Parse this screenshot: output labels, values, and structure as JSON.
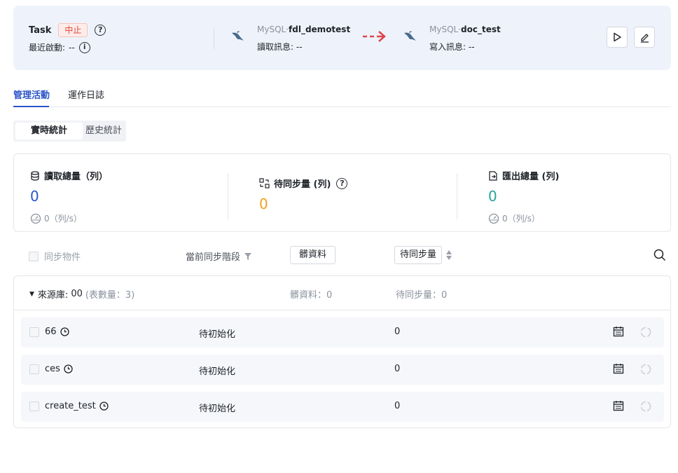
{
  "header": {
    "task_label": "Task",
    "status": "中止",
    "help_icon": "question-circle-icon",
    "recent_label": "最近啟動:",
    "recent_value": "--",
    "source": {
      "prefix": "MySQL·",
      "name": "fdl_demotest",
      "info_label": "讀取訊息:",
      "info_value": "--",
      "icon": "mysql-dolphin-icon"
    },
    "target": {
      "prefix": "MySQL·",
      "name": "doc_test",
      "info_label": "寫入訊息:",
      "info_value": "--",
      "icon": "mysql-dolphin-icon"
    },
    "arrow_color": "#e0454b",
    "actions": [
      "play-icon",
      "edit-icon"
    ]
  },
  "tabs": [
    {
      "label": "管理活動",
      "active": true
    },
    {
      "label": "運作日誌",
      "active": false
    }
  ],
  "segment": {
    "active": "實時統計",
    "inactive": "歷史統計"
  },
  "stats": {
    "read": {
      "title": "讀取總量（列）",
      "value": "0",
      "rate": "0（列/s）",
      "color": "#2a55c9",
      "icon": "database-icon"
    },
    "pending": {
      "title": "待同步量 (列)",
      "value": "0",
      "color": "#f0a020",
      "icon": "sync-swap-icon"
    },
    "export": {
      "title": "匯出總量 (列)",
      "value": "0",
      "rate": "0（列/s）",
      "color": "#26a69a",
      "icon": "export-file-icon"
    }
  },
  "controls": {
    "sync_objects": "同步物件",
    "current_stage": "當前同步階段",
    "dirty_button": "髒資料",
    "pending_sort": "待同步量"
  },
  "table": {
    "source_label": "來源庫:",
    "source_name": "00",
    "table_count": "(表數量：3)",
    "dirty_summary": "髒資料：0",
    "pending_summary": "待同步量：0",
    "rows": [
      {
        "name": "66",
        "stage": "待初始化",
        "pending": "0"
      },
      {
        "name": "ces",
        "stage": "待初始化",
        "pending": "0"
      },
      {
        "name": "create_test",
        "stage": "待初始化",
        "pending": "0"
      }
    ]
  }
}
